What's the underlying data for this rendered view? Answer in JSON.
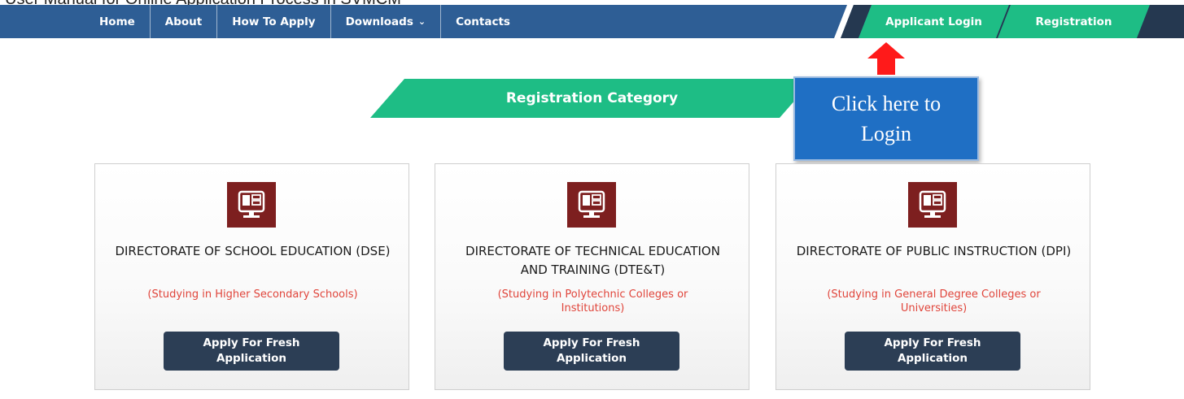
{
  "document": {
    "title": "User Manual for Online Application Process in SVMCM"
  },
  "nav": {
    "items": [
      {
        "label": "Home"
      },
      {
        "label": "About"
      },
      {
        "label": "How To Apply"
      },
      {
        "label": "Downloads",
        "caret": "⌄"
      },
      {
        "label": "Contacts"
      }
    ],
    "applicant_login": "Applicant Login",
    "registration": "Registration"
  },
  "banner": {
    "title": "Registration Category"
  },
  "callout": {
    "text": "Click here to Login",
    "arrow_icon": "red-up-arrow"
  },
  "cards": [
    {
      "title": "DIRECTORATE OF SCHOOL EDUCATION (DSE)",
      "subtitle": "(Studying in Higher Secondary Schools)",
      "button": "Apply For Fresh Application",
      "icon": "monitor-icon"
    },
    {
      "title": "DIRECTORATE OF TECHNICAL EDUCATION AND TRAINING (DTE&T)",
      "subtitle": "(Studying in Polytechnic Colleges or Institutions)",
      "button": "Apply For Fresh Application",
      "icon": "monitor-icon"
    },
    {
      "title": "DIRECTORATE OF PUBLIC INSTRUCTION (DPI)",
      "subtitle": "(Studying in General Degree Colleges or Universities)",
      "button": "Apply For Fresh Application",
      "icon": "monitor-icon"
    }
  ],
  "colors": {
    "nav_blue": "#2e5e95",
    "nav_dark": "#253850",
    "accent_green": "#1ebd85",
    "callout_blue": "#1f6fc4",
    "icon_maroon": "#7d1f1f",
    "subtitle_red": "#e0453b",
    "button_dark": "#2c3e55",
    "arrow_red": "#ff1a1a"
  }
}
